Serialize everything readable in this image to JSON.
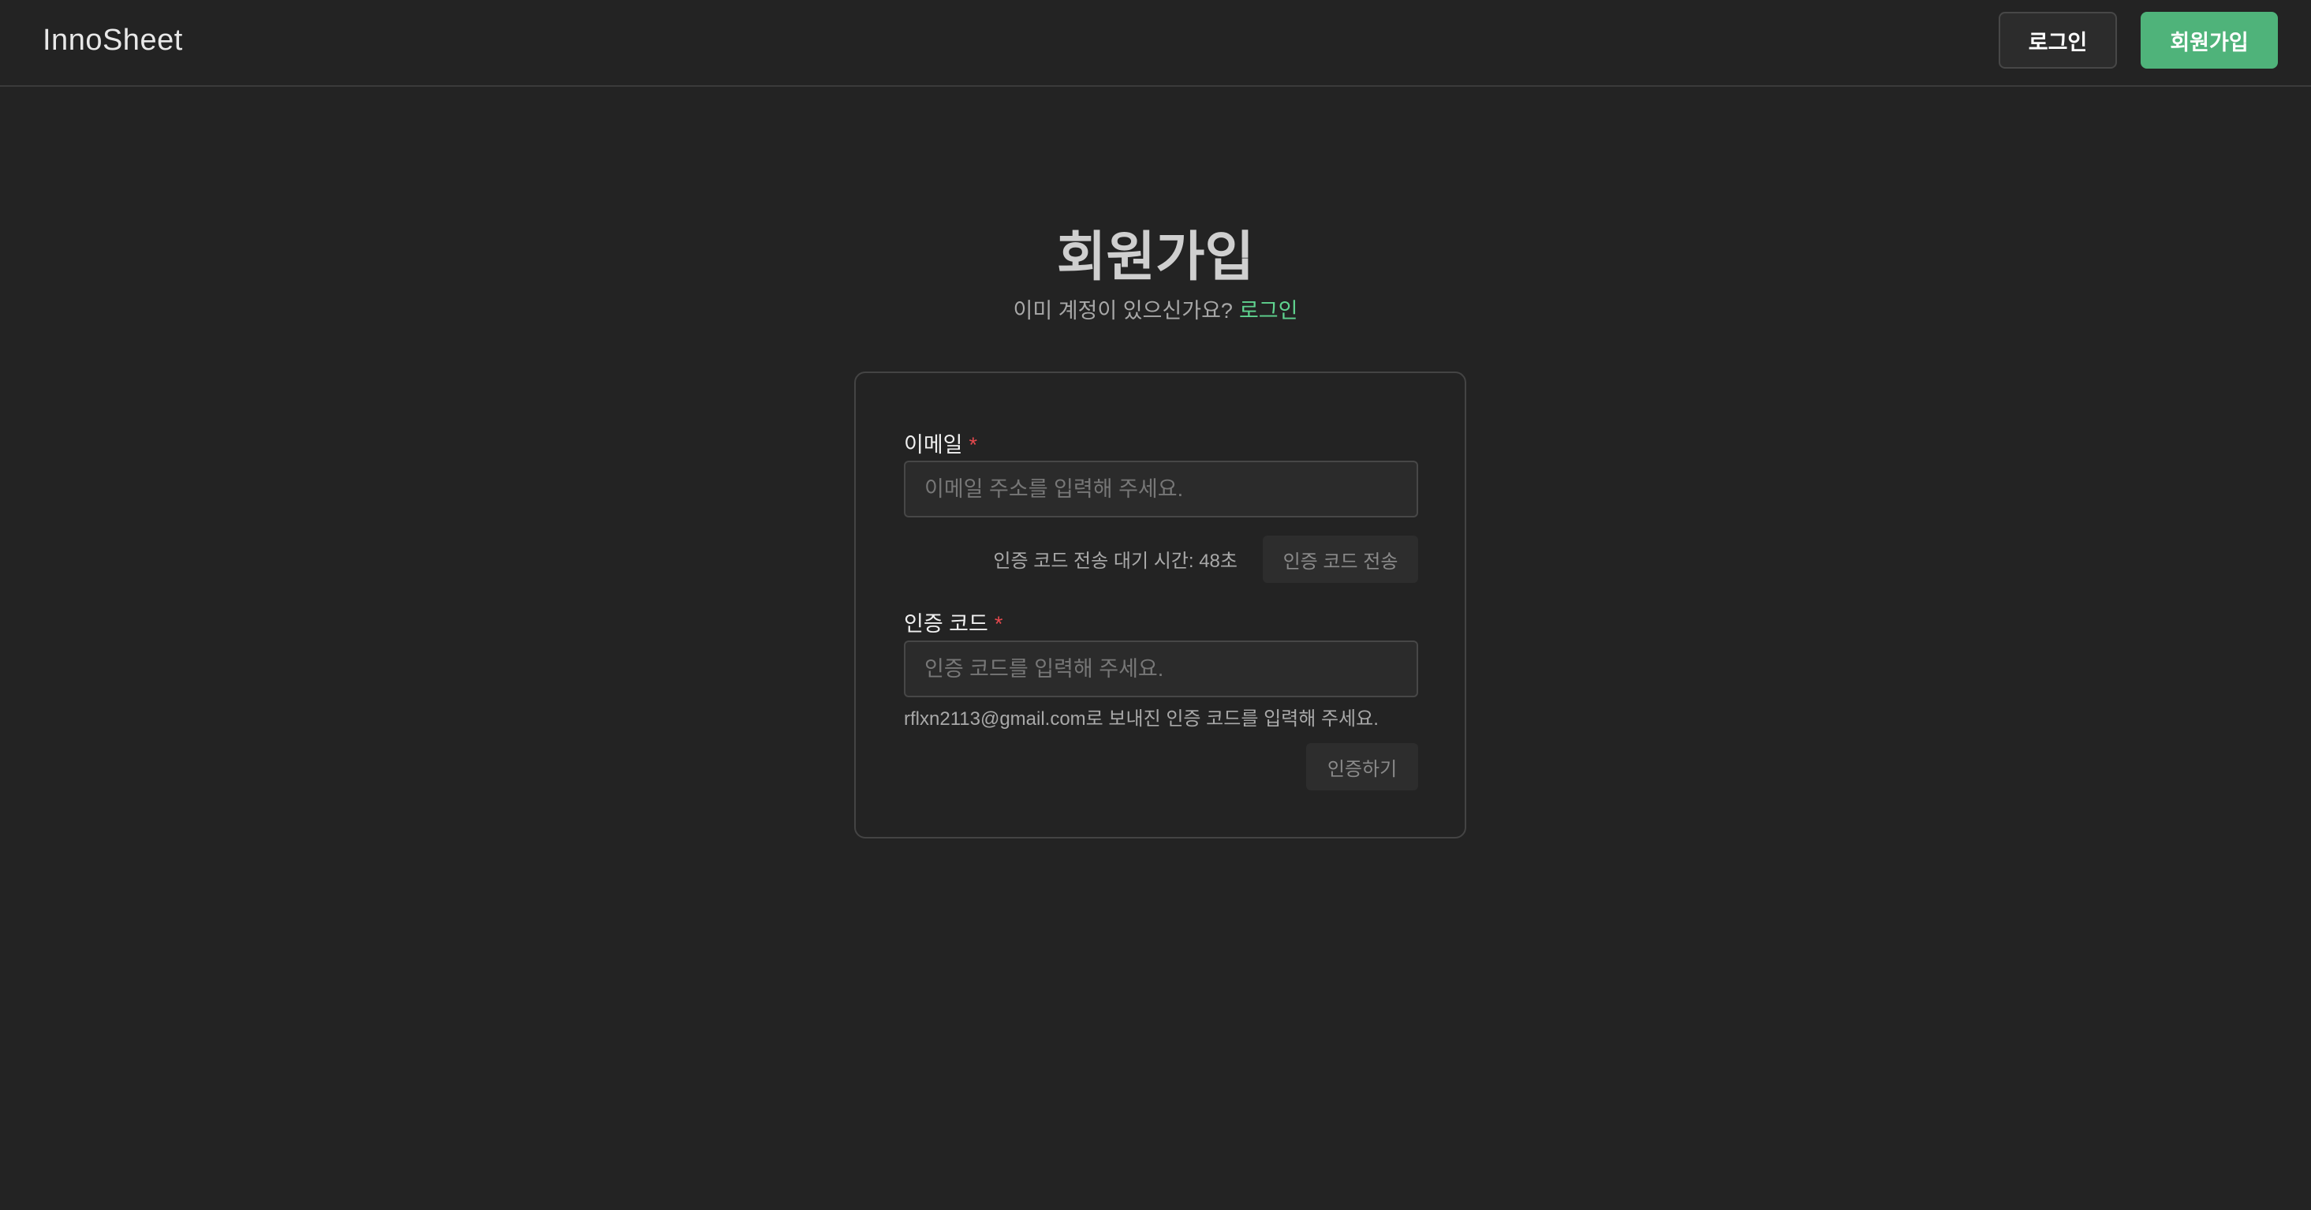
{
  "header": {
    "brand": "InnoSheet",
    "login_label": "로그인",
    "signup_label": "회원가입",
    "signup_color": "#4fb37a"
  },
  "page": {
    "title": "회원가입",
    "subtitle": "이미 계정이 있으신가요?",
    "login_link": "로그인"
  },
  "form": {
    "email": {
      "label": "이메일",
      "required_mark": "*",
      "placeholder": "이메일 주소를 입력해 주세요.",
      "value": ""
    },
    "timer_text": "인증 코드 전송 대기 시간: 48초",
    "send_code_label": "인증 코드 전송",
    "code": {
      "label": "인증 코드",
      "required_mark": "*",
      "placeholder": "인증 코드를 입력해 주세요.",
      "value": "",
      "hint": "rflxn2113@gmail.com로 보내진 인증 코드를 입력해 주세요."
    },
    "verify_label": "인증하기"
  }
}
